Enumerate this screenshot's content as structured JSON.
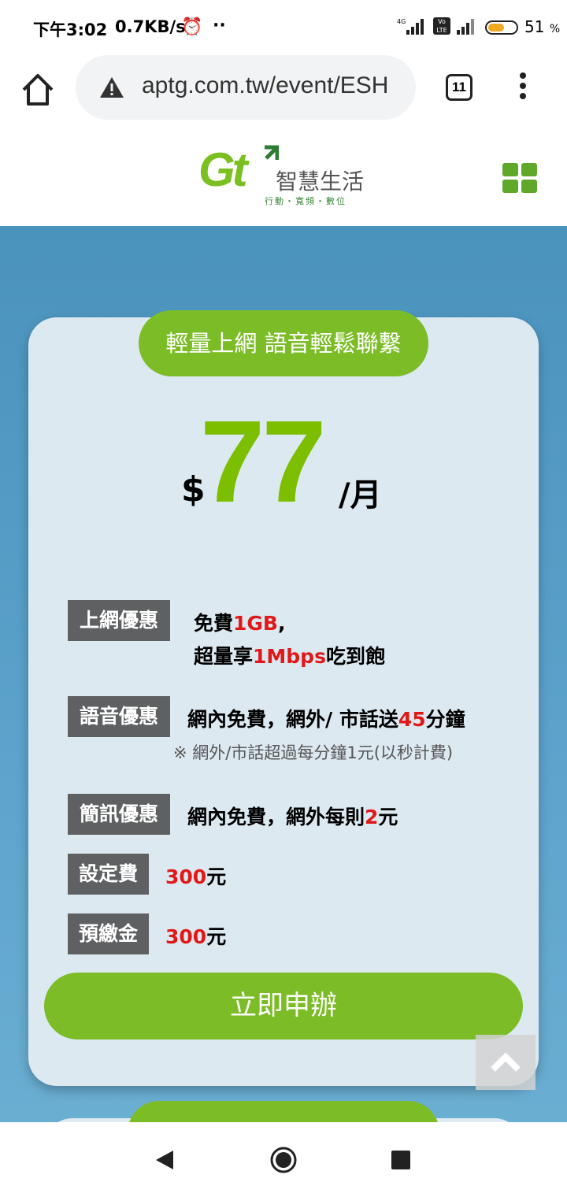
{
  "status_bar": {
    "time": "下午3:02",
    "speed": "0.7KB/s",
    "alarm_icon": "alarm-clock-icon",
    "dots": "··",
    "network": "4G",
    "volte": "Vo LTE",
    "battery_percent": "51",
    "battery_unit": "%"
  },
  "browser": {
    "url": "aptg.com.tw/event/ESH",
    "tab_count": "11"
  },
  "site": {
    "logo_mark": "Gt",
    "logo_name": "智慧生活",
    "logo_tagline": "行動・寬頻・數位"
  },
  "plan": {
    "title": "輕量上網 語音輕鬆聯繫",
    "price_currency": "$",
    "price": "77",
    "price_unit": "/月",
    "features": [
      {
        "label": "上網優惠",
        "line1_a": "免費",
        "line1_red": "1GB",
        "line1_b": ",",
        "line2_a": "超量享",
        "line2_red": "1Mbps",
        "line2_b": "吃到飽"
      },
      {
        "label": "語音優惠",
        "text_a": "網內免費，網外/ 市話送",
        "text_red": "45",
        "text_b": "分鐘",
        "note": "※ 網外/市話超過每分鐘1元(以秒計費)"
      },
      {
        "label": "簡訊優惠",
        "text_a": "網內免費，網外每則",
        "text_red": "2",
        "text_b": "元"
      },
      {
        "label": "設定費",
        "text_red": "300",
        "text_b": "元"
      },
      {
        "label": "預繳金",
        "text_red": "300",
        "text_b": "元"
      }
    ],
    "cta_label": "立即申辦"
  },
  "colors": {
    "brand_green": "#7cbd27",
    "price_green": "#7bbf00",
    "highlight_red": "#e01818",
    "tag_gray": "#5e6062",
    "page_blue": "#5da3cc"
  }
}
